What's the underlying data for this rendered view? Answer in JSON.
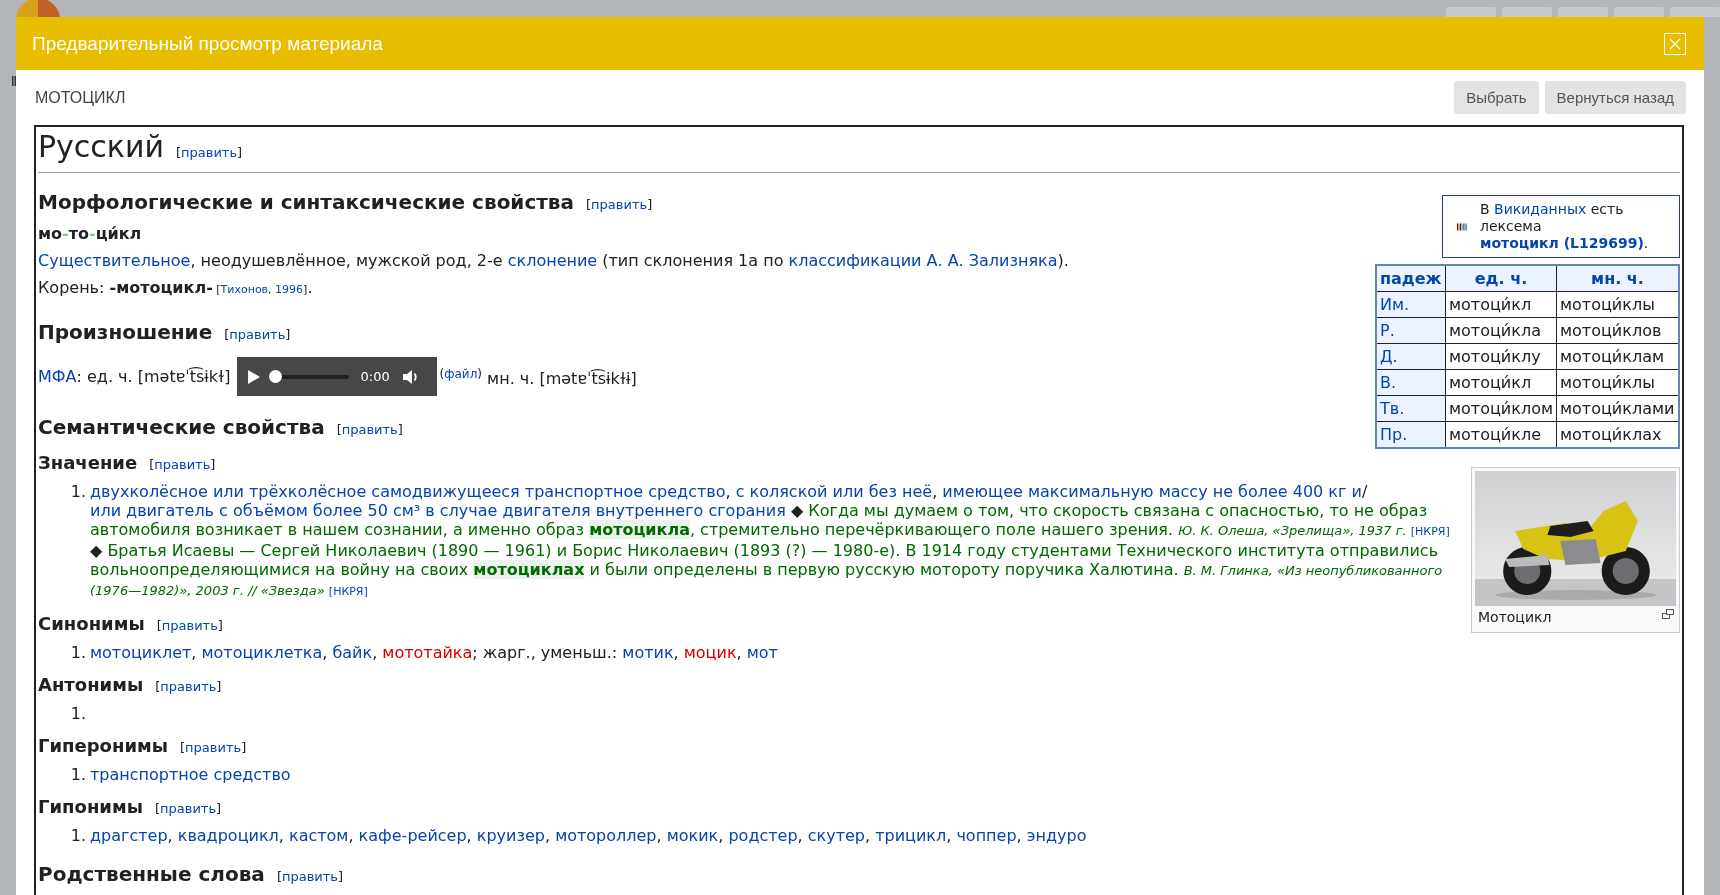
{
  "dialog": {
    "title": "Предварительный просмотр материала"
  },
  "material": {
    "name": "МОТОЦИКЛ",
    "buttons": [
      "Выбрать",
      "Вернуться назад"
    ]
  },
  "article": {
    "language": {
      "title": "Русский",
      "edit": [
        "[",
        "править",
        "]"
      ]
    },
    "aside": [
      {
        "kind": "wikidata",
        "runs": [
          {
            "kind": "text",
            "text": "В "
          },
          {
            "kind": "link",
            "text": "Викиданных"
          },
          {
            "kind": "text",
            "text": " есть лексема "
          },
          {
            "kind": "link_bold",
            "text": "мотоцикл "
          },
          {
            "kind": "link_bold",
            "text": "(L129699)"
          },
          {
            "kind": "text",
            "text": "."
          }
        ]
      },
      {
        "kind": "table",
        "columns": [
          "падеж",
          "ед. ч.",
          "мн. ч."
        ],
        "rows": [
          [
            "Им.",
            "мотоци́кл",
            "мотоци́клы"
          ],
          [
            "Р.",
            "мотоци́кла",
            "мотоци́клов"
          ],
          [
            "Д.",
            "мотоци́клу",
            "мотоци́клам"
          ],
          [
            "В.",
            "мотоци́кл",
            "мотоци́клы"
          ],
          [
            "Тв.",
            "мотоци́клом",
            "мотоци́клами"
          ],
          [
            "Пр.",
            "мотоци́кле",
            "мотоци́клах"
          ]
        ]
      },
      {
        "kind": "figure",
        "caption": "Мотоцикл"
      }
    ],
    "sections": [
      {
        "kind": "h3",
        "title": "Морфологические и синтаксические свойства",
        "edit": [
          "[",
          "править",
          "]"
        ],
        "blocks": [
          {
            "kind": "syllables",
            "runs": [
              {
                "kind": "bold",
                "text": "мо"
              },
              {
                "kind": "hyphen",
                "text": "-"
              },
              {
                "kind": "bold",
                "text": "то"
              },
              {
                "kind": "hyphen",
                "text": "-"
              },
              {
                "kind": "bold",
                "text": "ци́кл"
              }
            ]
          },
          {
            "kind": "para",
            "runs": [
              {
                "kind": "link",
                "text": "Существительное"
              },
              {
                "kind": "text",
                "text": ", неодушевлённое, мужской род, 2-е "
              },
              {
                "kind": "link",
                "text": "склонение"
              },
              {
                "kind": "text",
                "text": " (тип склонения 1a по "
              },
              {
                "kind": "link",
                "text": "классификации А. А. Зализняка"
              },
              {
                "kind": "text",
                "text": ")."
              }
            ]
          },
          {
            "kind": "para",
            "runs": [
              {
                "kind": "text",
                "text": "Корень: "
              },
              {
                "kind": "bold",
                "text": "-мотоцикл-"
              },
              {
                "kind": "small",
                "text": " ["
              },
              {
                "kind": "ref",
                "text": "Тихонов, 1996"
              },
              {
                "kind": "small",
                "text": "]"
              },
              {
                "kind": "text",
                "text": "."
              }
            ]
          }
        ]
      },
      {
        "kind": "h3",
        "title": "Произношение",
        "edit": [
          "[",
          "править",
          "]"
        ],
        "blocks": [
          {
            "kind": "audio",
            "before": [
              {
                "kind": "link",
                "text": "МФА"
              },
              {
                "kind": "text",
                "text": ": ед. ч. [mətɐˈt͡sɨkɫ]"
              }
            ],
            "player": {
              "time": "0:00",
              "level": 0
            },
            "after": [
              {
                "kind": "sup_text",
                "text": "("
              },
              {
                "kind": "sup_link",
                "text": "файл"
              },
              {
                "kind": "sup_text",
                "text": ")"
              },
              {
                "kind": "text",
                "text": " мн. ч. [mətɐˈt͡sɨkɫɨ]"
              }
            ]
          }
        ]
      },
      {
        "kind": "h3",
        "title": "Семантические свойства",
        "edit": [
          "[",
          "править",
          "]"
        ]
      },
      {
        "kind": "h4",
        "title": "Значение",
        "edit": [
          "[",
          "править",
          "]"
        ],
        "blocks": [
          {
            "kind": "list",
            "items": [
              {
                "number": "1.",
                "runs": [
                  {
                    "kind": "link",
                    "text": "двухколёсное или трёхколёсное самодвижущееся транспортное средство"
                  },
                  {
                    "kind": "text",
                    "text": ", "
                  },
                  {
                    "kind": "link",
                    "text": "с коляской или без неё"
                  },
                  {
                    "kind": "text",
                    "text": ", "
                  },
                  {
                    "kind": "link",
                    "text": "имеющее максимальную массу не более 400 кг и"
                  },
                  {
                    "kind": "text",
                    "text": "/"
                  },
                  {
                    "kind": "link",
                    "text": "или "
                  },
                  {
                    "kind": "link",
                    "text": "двигатель с объёмом более 50 см³ в случае двигателя внутреннего сгорания"
                  },
                  {
                    "kind": "text",
                    "text": " ◆ "
                  },
                  {
                    "kind": "example",
                    "text": "Когда мы думаем о том, что скорость связана с опасностью, то не образ автомобиля возникает в нашем сознании, а именно образ "
                  },
                  {
                    "kind": "example_bold",
                    "text": "мотоцикла"
                  },
                  {
                    "kind": "example",
                    "text": ", стремительно перечёркивающего поле нашего зрения. "
                  },
                  {
                    "kind": "cite",
                    "text": "Ю. К. Олеша, «Зрелища», 1937 г. "
                  },
                  {
                    "kind": "ref",
                    "text": "[НКРЯ]"
                  },
                  {
                    "kind": "text",
                    "text": " ◆ "
                  },
                  {
                    "kind": "example",
                    "text": "Братья Исаевы  — Сергей Николаевич (1890 — 1961) и Борис Николаевич (1893 (?) — 1980-е). В 1914 году студентами Технического института отправились вольноопределяющимися на войну на своих "
                  },
                  {
                    "kind": "example_bold",
                    "text": "мотоциклах"
                  },
                  {
                    "kind": "example",
                    "text": " и были определены в первую русскую мотороту поручика Халютина. "
                  },
                  {
                    "kind": "cite",
                    "text": "В. М. Глинка, «Из неопубликованного (1976—1982)», 2003 г. // «Звезда» "
                  },
                  {
                    "kind": "ref",
                    "text": "[НКРЯ]"
                  }
                ]
              }
            ]
          }
        ]
      },
      {
        "kind": "h4",
        "title": "Синонимы",
        "edit": [
          "[",
          "править",
          "]"
        ],
        "blocks": [
          {
            "kind": "list",
            "items": [
              {
                "number": "1.",
                "runs": [
                  {
                    "kind": "link",
                    "text": "мотоциклет"
                  },
                  {
                    "kind": "text",
                    "text": ", "
                  },
                  {
                    "kind": "link",
                    "text": "мотоциклетка"
                  },
                  {
                    "kind": "text",
                    "text": ", "
                  },
                  {
                    "kind": "link",
                    "text": "байк"
                  },
                  {
                    "kind": "text",
                    "text": ", "
                  },
                  {
                    "kind": "redlink",
                    "text": "мототайка"
                  },
                  {
                    "kind": "text",
                    "text": "; жарг., уменьш.: "
                  },
                  {
                    "kind": "link",
                    "text": "мотик"
                  },
                  {
                    "kind": "text",
                    "text": ", "
                  },
                  {
                    "kind": "redlink",
                    "text": "моцик"
                  },
                  {
                    "kind": "text",
                    "text": ", "
                  },
                  {
                    "kind": "link",
                    "text": "мот"
                  }
                ]
              }
            ]
          }
        ]
      },
      {
        "kind": "h4",
        "title": "Антонимы",
        "edit": [
          "[",
          "править",
          "]"
        ],
        "blocks": [
          {
            "kind": "list",
            "items": [
              {
                "number": "1."
              }
            ]
          }
        ]
      },
      {
        "kind": "h4",
        "title": "Гиперонимы",
        "edit": [
          "[",
          "править",
          "]"
        ],
        "blocks": [
          {
            "kind": "list",
            "items": [
              {
                "number": "1.",
                "runs": [
                  {
                    "kind": "link",
                    "text": "транспортное средство"
                  }
                ]
              }
            ]
          }
        ]
      },
      {
        "kind": "h4",
        "title": "Гипонимы",
        "edit": [
          "[",
          "править",
          "]"
        ],
        "blocks": [
          {
            "kind": "list",
            "items": [
              {
                "number": "1.",
                "runs": [
                  {
                    "kind": "link",
                    "text": "драгстер"
                  },
                  {
                    "kind": "text",
                    "text": ", "
                  },
                  {
                    "kind": "link",
                    "text": "квадроцикл"
                  },
                  {
                    "kind": "text",
                    "text": ", "
                  },
                  {
                    "kind": "link",
                    "text": "кастом"
                  },
                  {
                    "kind": "text",
                    "text": ", "
                  },
                  {
                    "kind": "link",
                    "text": "кафе-рейсер"
                  },
                  {
                    "kind": "text",
                    "text": ", "
                  },
                  {
                    "kind": "link",
                    "text": "круизер"
                  },
                  {
                    "kind": "text",
                    "text": ", "
                  },
                  {
                    "kind": "link",
                    "text": "мотороллер"
                  },
                  {
                    "kind": "text",
                    "text": ", "
                  },
                  {
                    "kind": "link",
                    "text": "мокик"
                  },
                  {
                    "kind": "text",
                    "text": ", "
                  },
                  {
                    "kind": "link",
                    "text": "родстер"
                  },
                  {
                    "kind": "text",
                    "text": ", "
                  },
                  {
                    "kind": "link",
                    "text": "скутер"
                  },
                  {
                    "kind": "text",
                    "text": ", "
                  },
                  {
                    "kind": "link",
                    "text": "трицикл"
                  },
                  {
                    "kind": "text",
                    "text": ", "
                  },
                  {
                    "kind": "link",
                    "text": "чоппер"
                  },
                  {
                    "kind": "text",
                    "text": ", "
                  },
                  {
                    "kind": "link",
                    "text": "эндуро"
                  }
                ]
              }
            ]
          }
        ]
      },
      {
        "kind": "h3",
        "title": "Родственные слова",
        "edit": [
          "[",
          "править",
          "]"
        ]
      }
    ]
  }
}
